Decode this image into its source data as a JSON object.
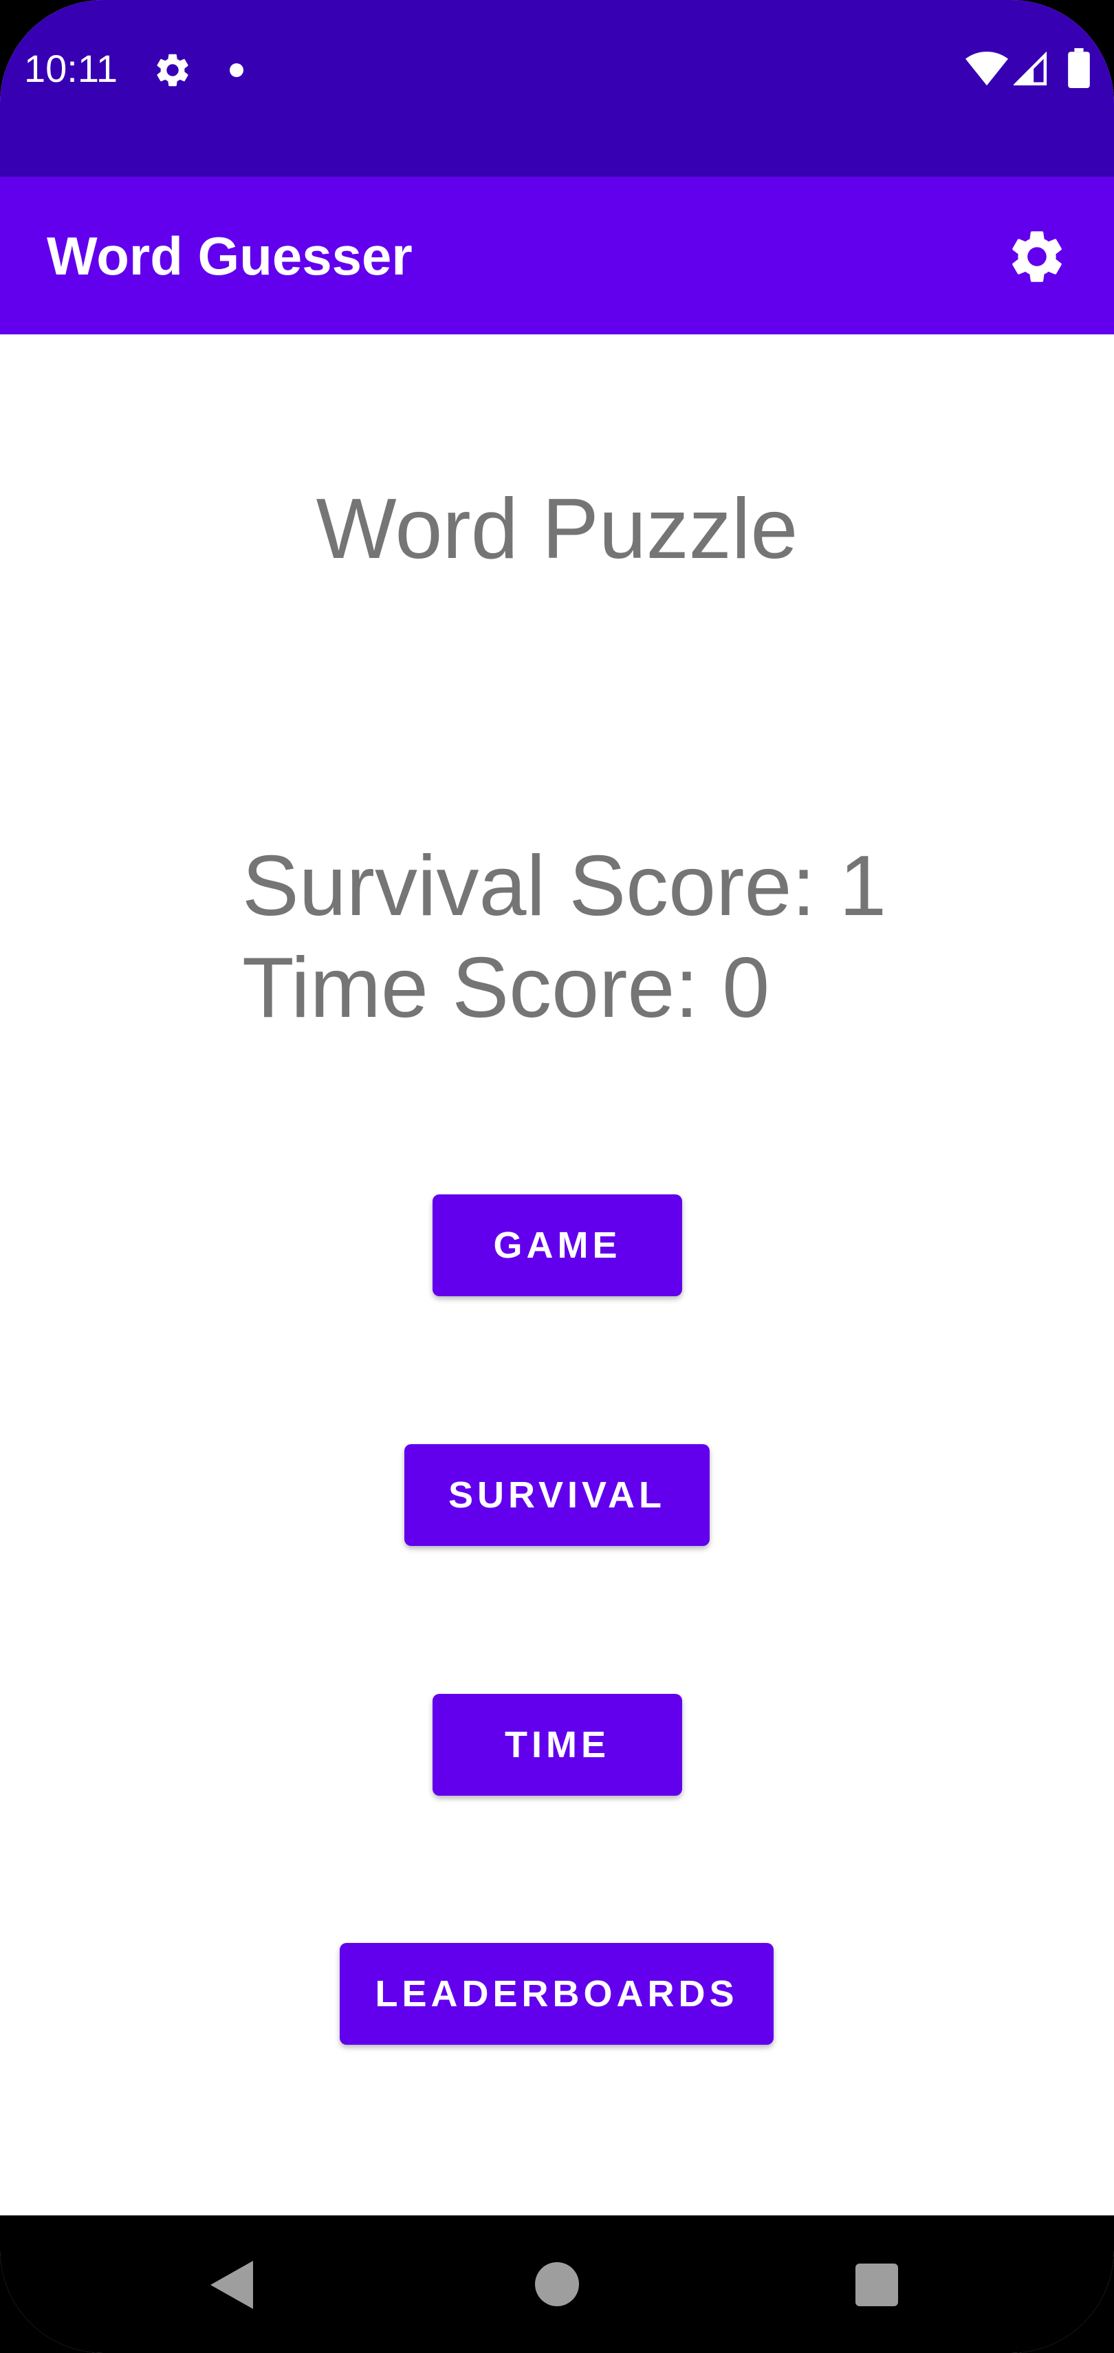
{
  "status_bar": {
    "time": "10:11",
    "icons": [
      "gear-icon",
      "notification-dot-icon",
      "wifi-icon",
      "signal-icon",
      "battery-icon"
    ]
  },
  "app_bar": {
    "title": "Word Guesser",
    "settings_icon": "gear-icon"
  },
  "main": {
    "heading": "Word Puzzle",
    "survival_score": "Survival Score: 1",
    "time_score": "Time Score: 0",
    "buttons": {
      "game": "GAME",
      "survival": "SURVIVAL",
      "time": "TIME",
      "leaderboards": "LEADERBOARDS"
    }
  },
  "nav_bar": {
    "icons": [
      "back-icon",
      "home-icon",
      "recents-icon"
    ]
  },
  "colors": {
    "status_bar": "#3700b3",
    "primary": "#6200ee",
    "text_secondary": "#757575",
    "on_primary": "#ffffff"
  }
}
